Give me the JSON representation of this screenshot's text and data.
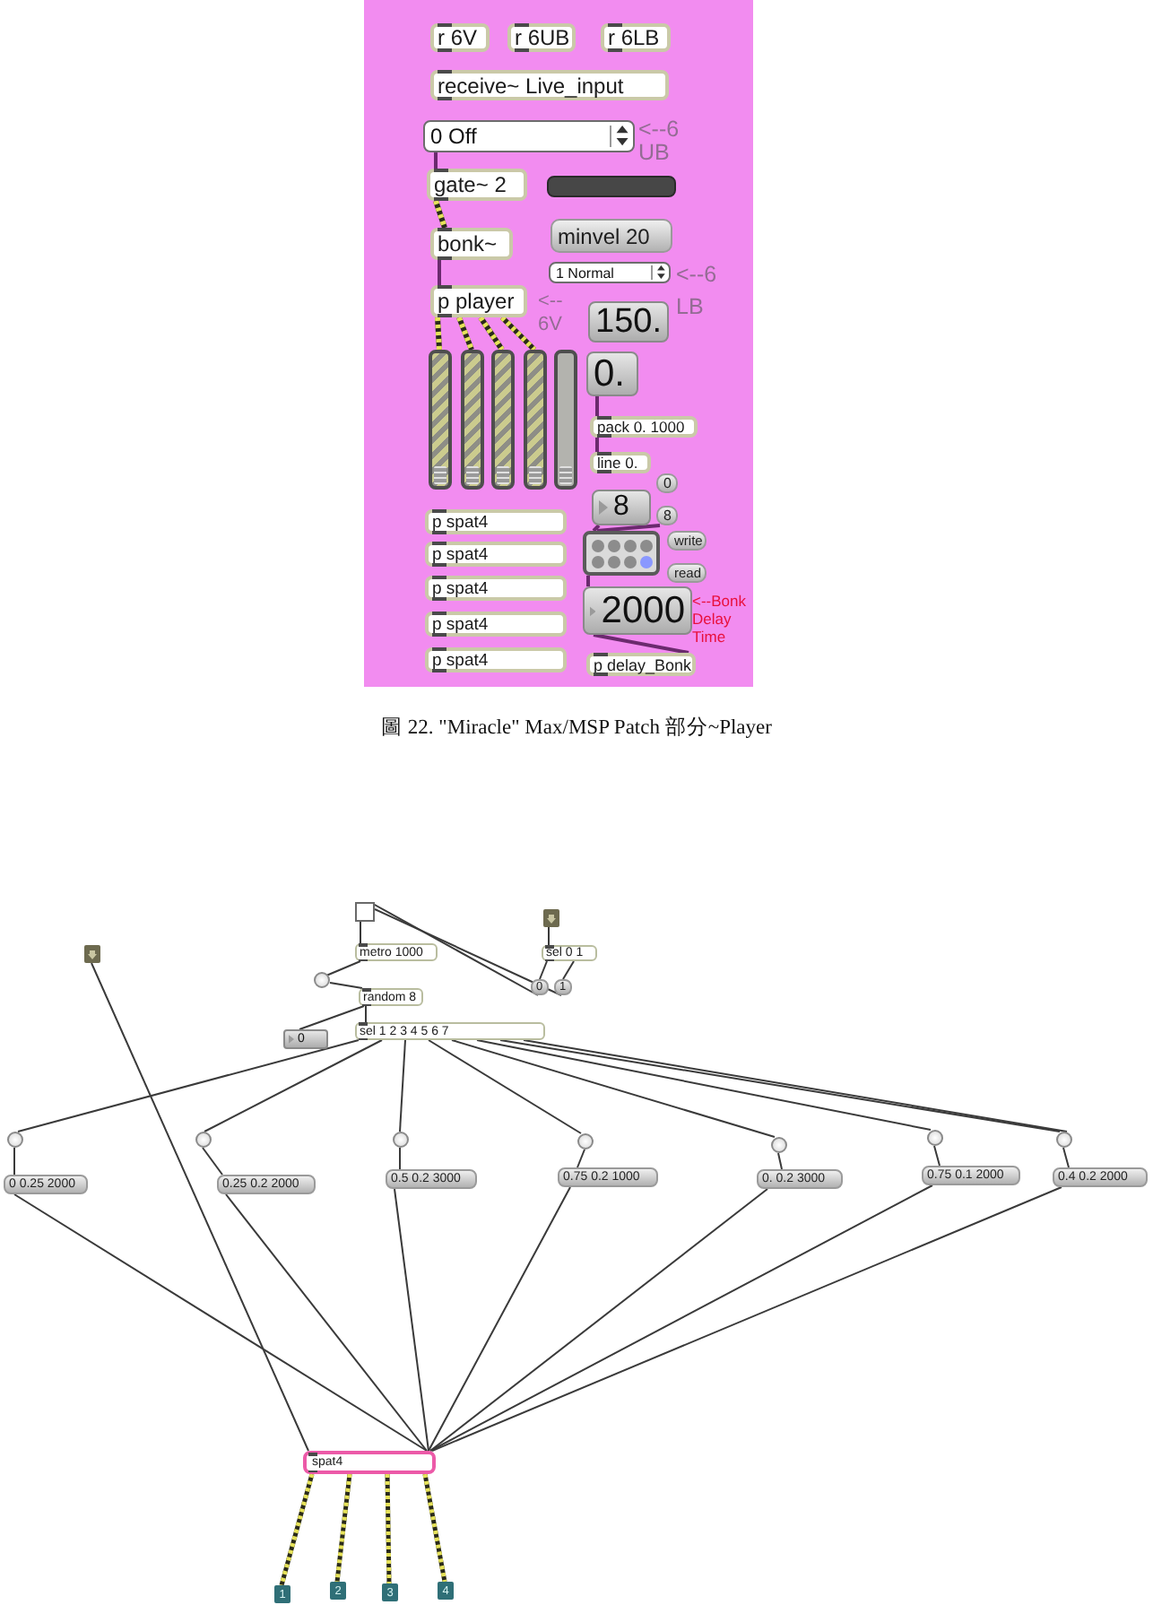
{
  "player_patch": {
    "objects": [
      {
        "kind": "object",
        "text": "r 6V"
      },
      {
        "kind": "object",
        "text": "r 6UB"
      },
      {
        "kind": "object",
        "text": "r 6LB"
      },
      {
        "kind": "object",
        "text": "receive~ Live_input"
      },
      {
        "kind": "menu",
        "text": "0 Off"
      },
      {
        "kind": "comment",
        "text": "<--6 UB",
        "color": "#946c94"
      },
      {
        "kind": "object",
        "text": "gate~ 2"
      },
      {
        "kind": "meter"
      },
      {
        "kind": "object",
        "text": "bonk~"
      },
      {
        "kind": "message",
        "text": "minvel 20"
      },
      {
        "kind": "menu",
        "text": "1 Normal"
      },
      {
        "kind": "object",
        "text": "p player"
      },
      {
        "kind": "comment",
        "text": "<-- 6V",
        "color": "#946c94"
      },
      {
        "kind": "number",
        "text": "150.",
        "show_triangle": false
      },
      {
        "kind": "comment",
        "text": "<--6 LB",
        "color": "#946c94"
      },
      {
        "kind": "slider",
        "connected": true,
        "level": 0
      },
      {
        "kind": "slider",
        "connected": true,
        "level": 0
      },
      {
        "kind": "slider",
        "connected": true,
        "level": 0
      },
      {
        "kind": "slider",
        "connected": true,
        "level": 0
      },
      {
        "kind": "slider",
        "connected": false,
        "level": 0
      },
      {
        "kind": "number",
        "text": "0.",
        "show_triangle": false
      },
      {
        "kind": "object",
        "text": "pack 0. 1000"
      },
      {
        "kind": "object",
        "text": "line 0."
      },
      {
        "kind": "number",
        "text": "8",
        "show_triangle": true
      },
      {
        "kind": "message",
        "text": "0"
      },
      {
        "kind": "message",
        "text": "8"
      },
      {
        "kind": "preset",
        "slots": [
          {
            "selected": false
          },
          {
            "selected": false
          },
          {
            "selected": false
          },
          {
            "selected": false
          },
          {
            "selected": false
          },
          {
            "selected": false
          },
          {
            "selected": false
          },
          {
            "selected": true
          }
        ]
      },
      {
        "kind": "message",
        "text": "write"
      },
      {
        "kind": "message",
        "text": "read"
      },
      {
        "kind": "number",
        "text": "2000",
        "show_triangle": true
      },
      {
        "kind": "comment",
        "text": "<--Bonk Delay Time",
        "color": "#e8103c"
      },
      {
        "kind": "object",
        "text": "p spat4"
      },
      {
        "kind": "object",
        "text": "p spat4"
      },
      {
        "kind": "object",
        "text": "p spat4"
      },
      {
        "kind": "object",
        "text": "p spat4"
      },
      {
        "kind": "object",
        "text": "p spat4"
      },
      {
        "kind": "object",
        "text": "p delay_Bonk"
      }
    ]
  },
  "caption": "圖 22. \"Miracle\" Max/MSP Patch 部分~Player",
  "spat_patch": {
    "objects": [
      {
        "kind": "inlet"
      },
      {
        "kind": "toggle",
        "on": false
      },
      {
        "kind": "inlet"
      },
      {
        "kind": "object",
        "text": "metro 1000"
      },
      {
        "kind": "object",
        "text": "sel 0 1"
      },
      {
        "kind": "bang"
      },
      {
        "kind": "message",
        "text": "0"
      },
      {
        "kind": "message",
        "text": "1"
      },
      {
        "kind": "object",
        "text": "random 8"
      },
      {
        "kind": "number",
        "text": "0",
        "show_triangle": true
      },
      {
        "kind": "object",
        "text": "sel 1 2 3 4 5 6 7"
      },
      {
        "kind": "bang"
      },
      {
        "kind": "bang"
      },
      {
        "kind": "bang"
      },
      {
        "kind": "bang"
      },
      {
        "kind": "bang"
      },
      {
        "kind": "bang"
      },
      {
        "kind": "bang"
      },
      {
        "kind": "message",
        "text": "0 0.25 2000"
      },
      {
        "kind": "message",
        "text": "0.25 0.2 2000"
      },
      {
        "kind": "message",
        "text": "0.5 0.2 3000"
      },
      {
        "kind": "message",
        "text": "0.75 0.2 1000"
      },
      {
        "kind": "message",
        "text": "0. 0.2 3000"
      },
      {
        "kind": "message",
        "text": "0.75 0.1 2000"
      },
      {
        "kind": "message",
        "text": "0.4 0.2 2000"
      },
      {
        "kind": "outlet",
        "text": "1"
      },
      {
        "kind": "outlet",
        "text": "2"
      },
      {
        "kind": "outlet",
        "text": "3"
      },
      {
        "kind": "outlet",
        "text": "4"
      }
    ],
    "output_object": {
      "text": "spat4",
      "selected": true
    }
  }
}
